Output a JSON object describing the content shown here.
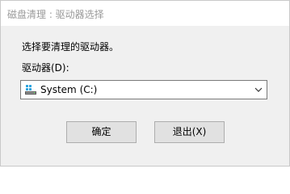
{
  "window": {
    "title": "磁盘清理 : 驱动器选择"
  },
  "dialog": {
    "prompt": "选择要清理的驱动器。",
    "drive_label": "驱动器(D):",
    "drive_select": {
      "selected": "System (C:)",
      "icon": "drive-icon"
    }
  },
  "buttons": {
    "ok_label": "确定",
    "exit_label": "退出(X)"
  },
  "colors": {
    "title_text": "#9a9a9a",
    "dialog_bg": "#f0f0f0",
    "button_bg": "#e1e1e1",
    "button_border": "#adadad",
    "select_border": "#7a7a7a",
    "drive_icon": "#2ea6e0"
  }
}
